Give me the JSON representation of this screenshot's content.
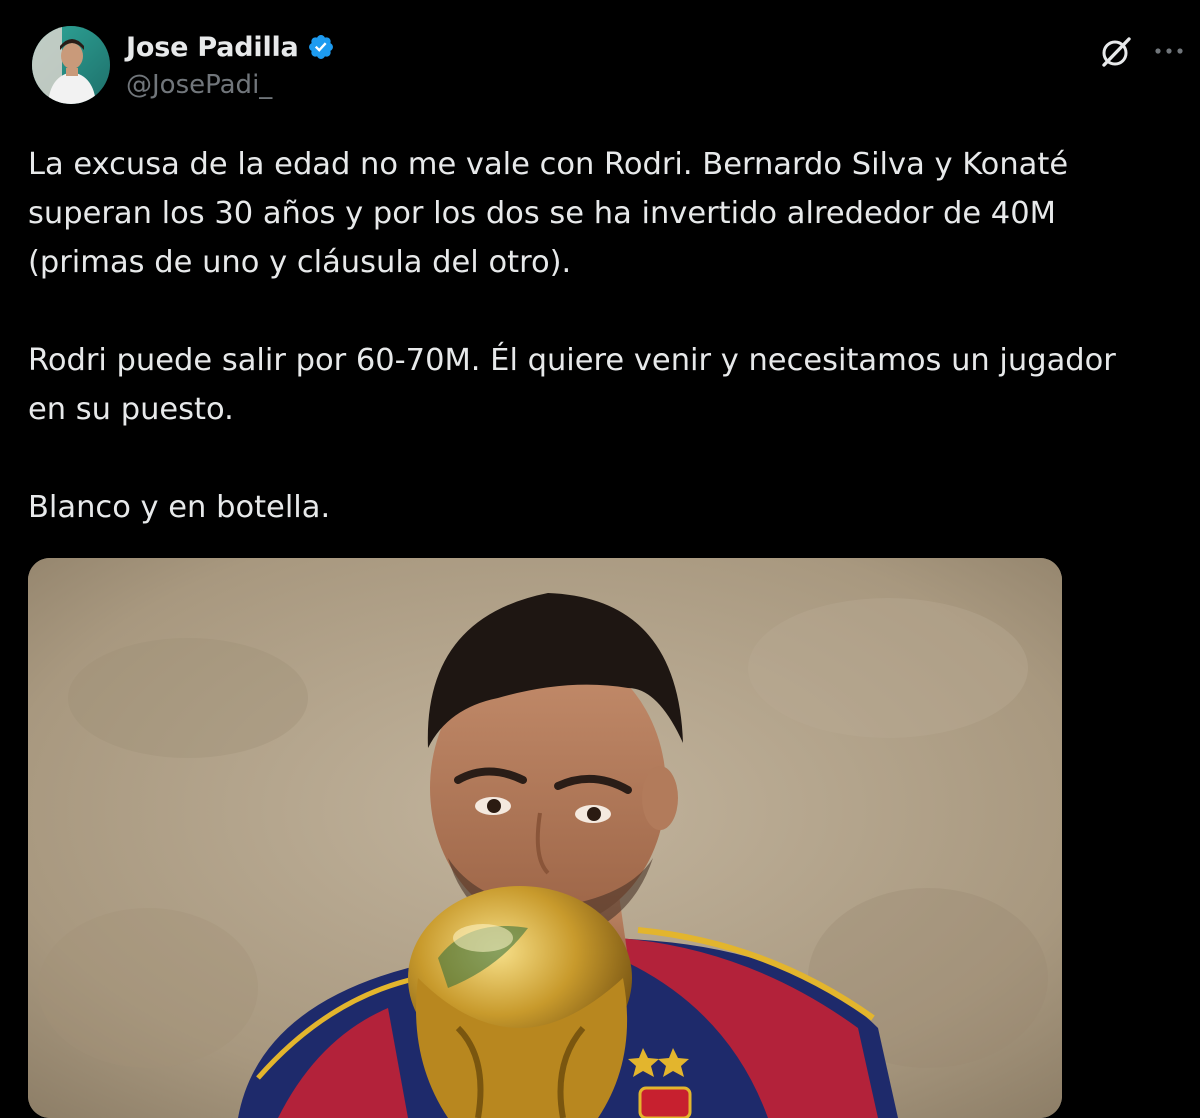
{
  "author": {
    "display_name": "Jose Padilla",
    "handle": "@JosePadi_",
    "verified": true,
    "avatar_icon": "profile-avatar"
  },
  "actions": {
    "grok_icon": "grok-icon",
    "more_icon": "more-dots-icon"
  },
  "tweet": {
    "paragraphs": [
      "La excusa de la edad no me vale con Rodri. Bernardo Silva y Konaté\nsuperan los 30 años y por los dos se ha invertido alrededor de 40M\n(primas de uno y cláusula del otro).",
      "Rodri puede salir por 60-70M. Él quiere venir y necesitamos un jugador\nen su puesto.",
      "Blanco y en botella."
    ]
  },
  "media": {
    "description_icon": "photo-player-with-trophy"
  },
  "colors": {
    "background": "#000000",
    "text": "#e7e9ea",
    "secondary_text": "#71767b",
    "verified_badge": "#1d9bf0"
  }
}
